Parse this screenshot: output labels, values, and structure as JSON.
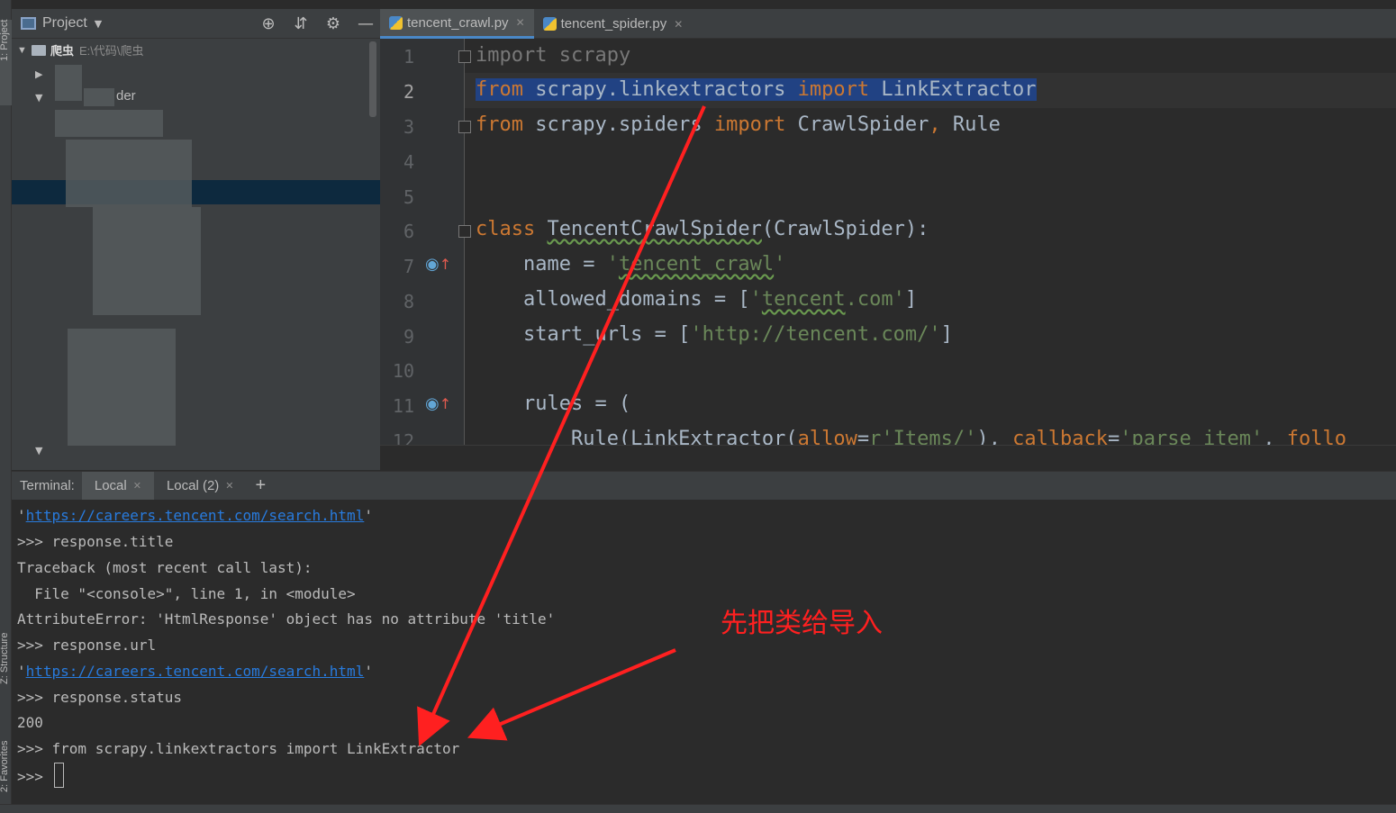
{
  "tool_strip": {
    "project": "1: Project",
    "structure": "Z: Structure",
    "favorites": "2: Favorites"
  },
  "project_panel": {
    "title": "Project",
    "root_name": "爬虫",
    "root_path": "E:\\代码\\爬虫",
    "visible_fragment": "der"
  },
  "editor": {
    "tabs": [
      {
        "label": "tencent_crawl.py",
        "active": true
      },
      {
        "label": "tencent_spider.py",
        "active": false
      }
    ],
    "line_numbers": [
      "1",
      "2",
      "3",
      "4",
      "5",
      "6",
      "7",
      "8",
      "9",
      "10",
      "11",
      "12"
    ]
  },
  "code": {
    "l1_kw": "import",
    "l1_mod": " scrapy",
    "l2_kw1": "from",
    "l2_mod": " scrapy.linkextractors ",
    "l2_kw2": "import",
    "l2_name": " LinkExtractor",
    "l3_kw1": "from",
    "l3_mod": " scrapy.spiders ",
    "l3_kw2": "import",
    "l3_rest": " CrawlSpider",
    "l3_comma": ",",
    "l3_rule": " Rule",
    "l6_kw": "class",
    "l6_space": " ",
    "l6_name": "TencentCrawlSpider",
    "l6_rest": "(CrawlSpider):",
    "l7_a": "    name = ",
    "l7_q1": "'",
    "l7_s": "tencent_crawl",
    "l7_q2": "'",
    "l8_a": "    allowed_domains = [",
    "l8_q1": "'",
    "l8_s": "tencent",
    "l8_s2": ".com'",
    "l8_b": "]",
    "l9_a": "    start_urls = [",
    "l9_s": "'http://tencent.com/'",
    "l9_b": "]",
    "l11_a": "    rules = (",
    "l12_a": "        Rule(LinkExtractor(",
    "l12_k1": "allow",
    "l12_eq": "=",
    "l12_s1": "r'Items/'",
    "l12_c": "), ",
    "l12_k2": "callback",
    "l12_eq2": "=",
    "l12_s2": "'parse_item'",
    "l12_c2": ", ",
    "l12_k3": "follo"
  },
  "terminal": {
    "label": "Terminal:",
    "tabs": [
      {
        "label": "Local"
      },
      {
        "label": "Local (2)"
      }
    ],
    "add": "+",
    "lines": {
      "l1_q1": "'",
      "l1_url": "https://careers.tencent.com/search.html",
      "l1_q2": "'",
      "l2": ">>> response.title",
      "l3": "Traceback (most recent call last):",
      "l4": "  File \"<console>\", line 1, in <module>",
      "l5": "AttributeError: 'HtmlResponse' object has no attribute 'title'",
      "l6": ">>> response.url",
      "l7_q1": "'",
      "l7_url": "https://careers.tencent.com/search.html",
      "l7_q2": "'",
      "l8": ">>> response.status",
      "l9": "200",
      "l10": ">>> from scrapy.linkextractors import LinkExtractor",
      "l11": ">>> "
    }
  },
  "annotation": {
    "text": "先把类给导入",
    "color": "#ff2020"
  },
  "colors": {
    "keyword": "#cc7832",
    "string": "#6a8759",
    "selection": "#214283",
    "link": "#287bde"
  }
}
